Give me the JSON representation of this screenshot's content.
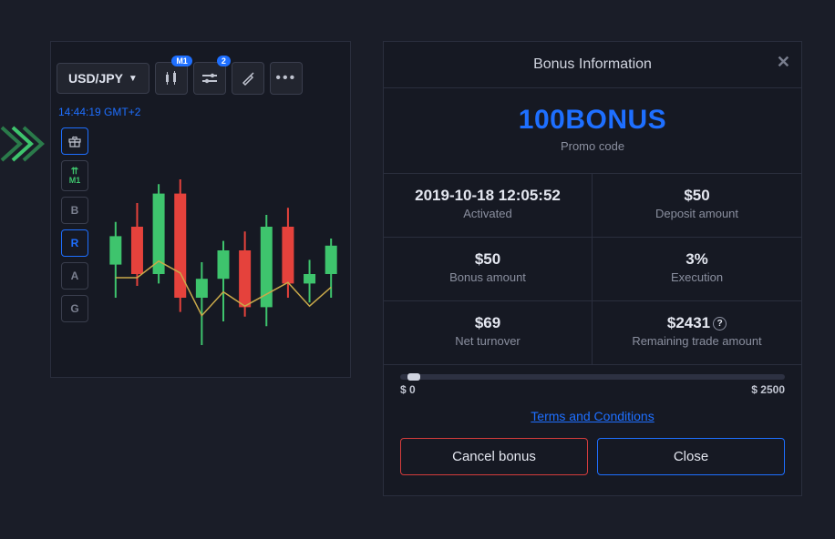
{
  "pair": "USD/JPY",
  "timeframe_badge": "M1",
  "settings_badge": "2",
  "timestamp": "14:44:19 GMT+2",
  "side_tools": {
    "m1_arrows": "M1",
    "b": "B",
    "r": "R",
    "a": "A",
    "g": "G"
  },
  "colors": {
    "up": "#3ec46d",
    "down": "#e5423c",
    "accent": "#1e6fff"
  },
  "chart_data": {
    "type": "candlestick",
    "interval": "M1",
    "candles": [
      {
        "o": 44,
        "h": 62,
        "l": 30,
        "c": 56,
        "dir": "up"
      },
      {
        "o": 60,
        "h": 70,
        "l": 35,
        "c": 40,
        "dir": "down"
      },
      {
        "o": 40,
        "h": 78,
        "l": 36,
        "c": 74,
        "dir": "up"
      },
      {
        "o": 74,
        "h": 80,
        "l": 24,
        "c": 30,
        "dir": "down"
      },
      {
        "o": 30,
        "h": 45,
        "l": 10,
        "c": 38,
        "dir": "up"
      },
      {
        "o": 38,
        "h": 54,
        "l": 20,
        "c": 50,
        "dir": "up"
      },
      {
        "o": 50,
        "h": 58,
        "l": 22,
        "c": 26,
        "dir": "down"
      },
      {
        "o": 26,
        "h": 65,
        "l": 18,
        "c": 60,
        "dir": "up"
      },
      {
        "o": 60,
        "h": 68,
        "l": 30,
        "c": 36,
        "dir": "down"
      },
      {
        "o": 36,
        "h": 46,
        "l": 28,
        "c": 40,
        "dir": "up"
      },
      {
        "o": 40,
        "h": 55,
        "l": 30,
        "c": 52,
        "dir": "up"
      }
    ]
  },
  "modal": {
    "title": "Bonus Information",
    "promo_code": "100BONUS",
    "promo_label": "Promo code",
    "cells": {
      "activated_val": "2019-10-18 12:05:52",
      "activated_lbl": "Activated",
      "deposit_val": "$50",
      "deposit_lbl": "Deposit amount",
      "bonus_val": "$50",
      "bonus_lbl": "Bonus amount",
      "execution_val": "3%",
      "execution_lbl": "Execution",
      "turnover_val": "$69",
      "turnover_lbl": "Net turnover",
      "remaining_val": "$2431",
      "remaining_lbl": "Remaining trade amount"
    },
    "progress_min": "$ 0",
    "progress_max": "$ 2500",
    "terms": "Terms and Conditions",
    "cancel": "Cancel bonus",
    "close": "Close"
  }
}
